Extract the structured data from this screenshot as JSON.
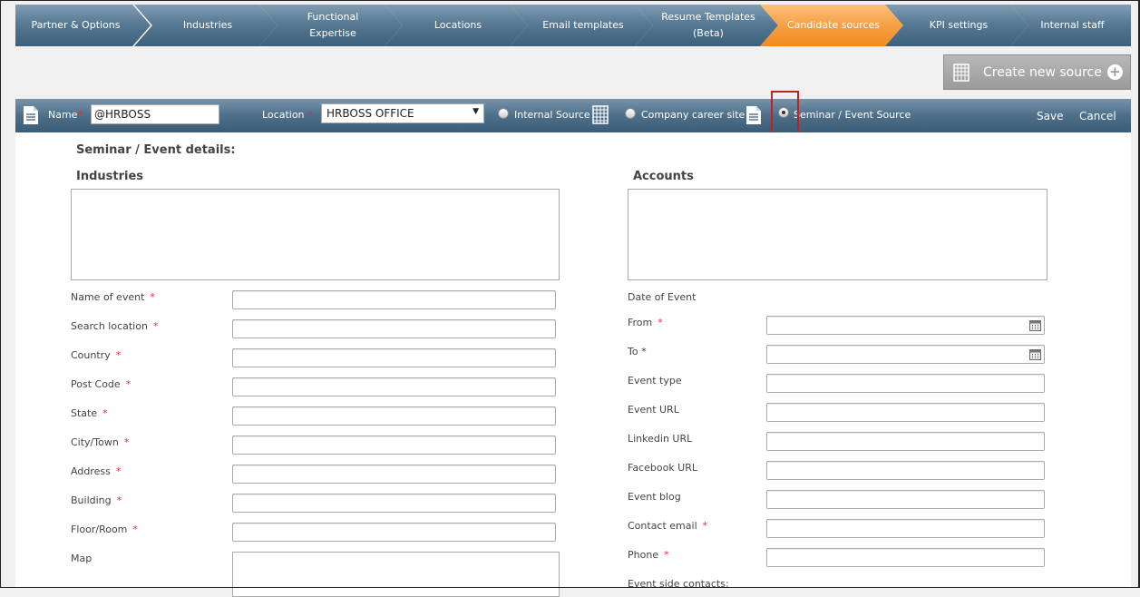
{
  "nav": {
    "steps": [
      {
        "label": "Partner & Options",
        "label2": ""
      },
      {
        "label": "Industries",
        "label2": ""
      },
      {
        "label": "Functional",
        "label2": "Expertise"
      },
      {
        "label": "Locations",
        "label2": ""
      },
      {
        "label": "Email templates",
        "label2": ""
      },
      {
        "label": "Resume Templates",
        "label2": "(Beta)"
      },
      {
        "label": "Candidate sources",
        "label2": "",
        "active": true
      },
      {
        "label": "KPI settings",
        "label2": ""
      },
      {
        "label": "Internal staff",
        "label2": ""
      }
    ],
    "active_color": "#f7a047",
    "base_color": "#587a94"
  },
  "create_button": {
    "label": "Create new source",
    "icon": "building-icon",
    "plus_icon": "plus-circle-icon"
  },
  "formbar": {
    "doc_icon": "document-icon",
    "name_label": "Name",
    "name_value": "@HRBOSS",
    "location_label": "Location",
    "location_value": "HRBOSS OFFICE",
    "required_mark": "*",
    "source_types": [
      {
        "label": "Internal Source",
        "icon": "building-icon",
        "checked": false
      },
      {
        "label": "Company career site",
        "icon": "document-icon",
        "checked": false
      },
      {
        "label": "Seminar / Event Source",
        "checked": true
      }
    ],
    "save_label": "Save",
    "cancel_label": "Cancel"
  },
  "details": {
    "title": "Seminar / Event details:",
    "industries_title": "Industries",
    "accounts_title": "Accounts",
    "left_fields": [
      {
        "label": "Name of event",
        "required": "*"
      },
      {
        "label": "Search location",
        "required": "*"
      },
      {
        "label": "Country",
        "required": "*"
      },
      {
        "label": "Post Code",
        "required": "*"
      },
      {
        "label": "State",
        "required": "*"
      },
      {
        "label": "City/Town",
        "required": "*"
      },
      {
        "label": "Address",
        "required": "*"
      },
      {
        "label": "Building",
        "required": "*"
      },
      {
        "label": "Floor/Room",
        "required": "*"
      },
      {
        "label": "Map",
        "required": ""
      }
    ],
    "date_label": "Date of Event",
    "right_fields": [
      {
        "label": "From",
        "required": "*",
        "calendar": true
      },
      {
        "label": "To",
        "required": "*",
        "calendar": true
      },
      {
        "label": "Event type",
        "required": ""
      },
      {
        "label": "Event URL",
        "required": ""
      },
      {
        "label": "Linkedin URL",
        "required": ""
      },
      {
        "label": "Facebook URL",
        "required": ""
      },
      {
        "label": "Event blog",
        "required": ""
      },
      {
        "label": "Contact email",
        "required": "*"
      },
      {
        "label": "Phone",
        "required": "*"
      }
    ],
    "contacts_label": "Event side contacts:"
  }
}
